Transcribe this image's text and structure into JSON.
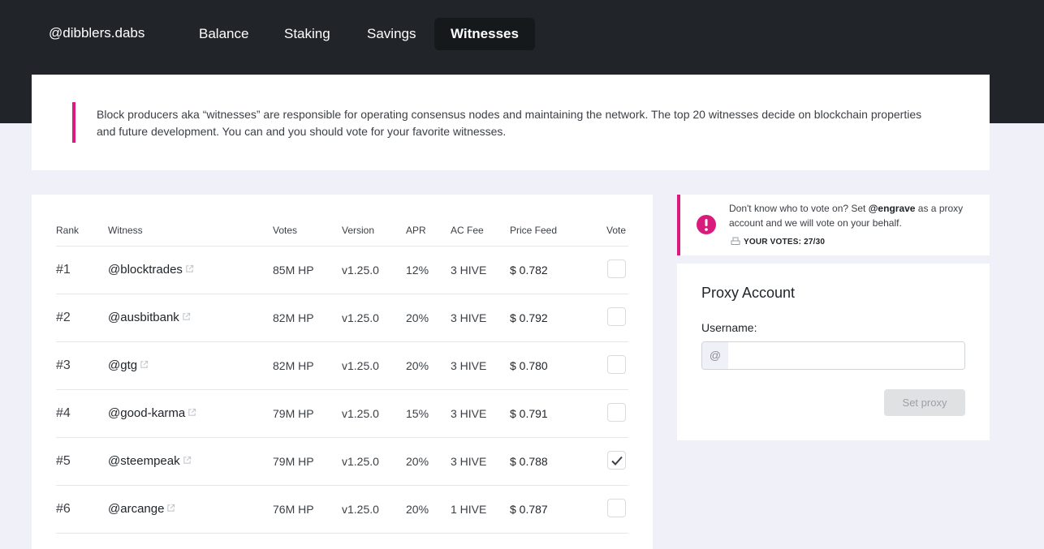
{
  "nav": {
    "brand": "@dibblers.dabs",
    "tabs": [
      {
        "label": "Balance",
        "active": false
      },
      {
        "label": "Staking",
        "active": false
      },
      {
        "label": "Savings",
        "active": false
      },
      {
        "label": "Witnesses",
        "active": true
      }
    ]
  },
  "intro": {
    "text": "Block producers aka “witnesses” are responsible for operating consensus nodes and maintaining the network. The top 20 witnesses decide on blockchain properties and future development. You can and you should vote for your favorite witnesses."
  },
  "table": {
    "headers": {
      "rank": "Rank",
      "witness": "Witness",
      "votes": "Votes",
      "version": "Version",
      "apr": "APR",
      "fee": "AC Fee",
      "feed": "Price Feed",
      "vote": "Vote"
    },
    "rows": [
      {
        "rank": "#1",
        "witness": "@blocktrades",
        "votes": "85M HP",
        "version": "v1.25.0",
        "apr": "12%",
        "fee": "3 HIVE",
        "feed": "$ 0.782",
        "voted": false
      },
      {
        "rank": "#2",
        "witness": "@ausbitbank",
        "votes": "82M HP",
        "version": "v1.25.0",
        "apr": "20%",
        "fee": "3 HIVE",
        "feed": "$ 0.792",
        "voted": false
      },
      {
        "rank": "#3",
        "witness": "@gtg",
        "votes": "82M HP",
        "version": "v1.25.0",
        "apr": "20%",
        "fee": "3 HIVE",
        "feed": "$ 0.780",
        "voted": false
      },
      {
        "rank": "#4",
        "witness": "@good-karma",
        "votes": "79M HP",
        "version": "v1.25.0",
        "apr": "15%",
        "fee": "3 HIVE",
        "feed": "$ 0.791",
        "voted": false
      },
      {
        "rank": "#5",
        "witness": "@steempeak",
        "votes": "79M HP",
        "version": "v1.25.0",
        "apr": "20%",
        "fee": "3 HIVE",
        "feed": "$ 0.788",
        "voted": true
      },
      {
        "rank": "#6",
        "witness": "@arcange",
        "votes": "76M HP",
        "version": "v1.25.0",
        "apr": "20%",
        "fee": "1 HIVE",
        "feed": "$ 0.787",
        "voted": false
      }
    ]
  },
  "notice": {
    "text_before": "Don't know who to vote on? Set ",
    "proxy_name": "@engrave",
    "text_after": " as a proxy account and we will vote on your behalf.",
    "votes_label": "YOUR VOTES: 27/30"
  },
  "proxy": {
    "title": "Proxy Account",
    "username_label": "Username:",
    "prefix": "@",
    "username_value": "",
    "button_label": "Set proxy"
  },
  "colors": {
    "accent": "#d81b7c",
    "header_bg": "#212529",
    "page_bg": "#eff0f8"
  }
}
